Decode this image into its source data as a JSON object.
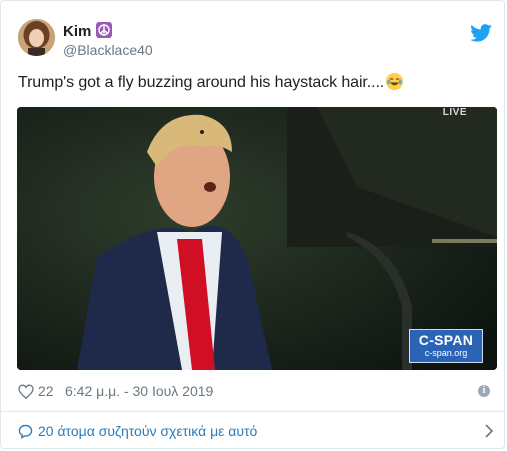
{
  "author": {
    "display_name": "Kim",
    "handle": "@Blacklace40",
    "badge_icon": "peace-symbol-icon",
    "avatar_icon": "profile-avatar"
  },
  "tweet": {
    "text": "Trump's got a fly buzzing around his haystack hair....",
    "emoji_icon": "face-with-tears-of-joy-emoji"
  },
  "media": {
    "live_label": "LIVE",
    "watermark_title": "C-SPAN",
    "watermark_url": "c-span.org"
  },
  "meta": {
    "like_count": "22",
    "timestamp": "6:42 μ.μ. - 30 Ιουλ 2019"
  },
  "discussion": {
    "label": "20 άτομα συζητούν σχετικά με αυτό"
  },
  "colors": {
    "link": "#2b7bb9",
    "twitter_blue": "#1da1f2",
    "secondary_text": "#697882",
    "badge_purple": "#9b59b6",
    "cspan_blue": "#2b64b7"
  }
}
